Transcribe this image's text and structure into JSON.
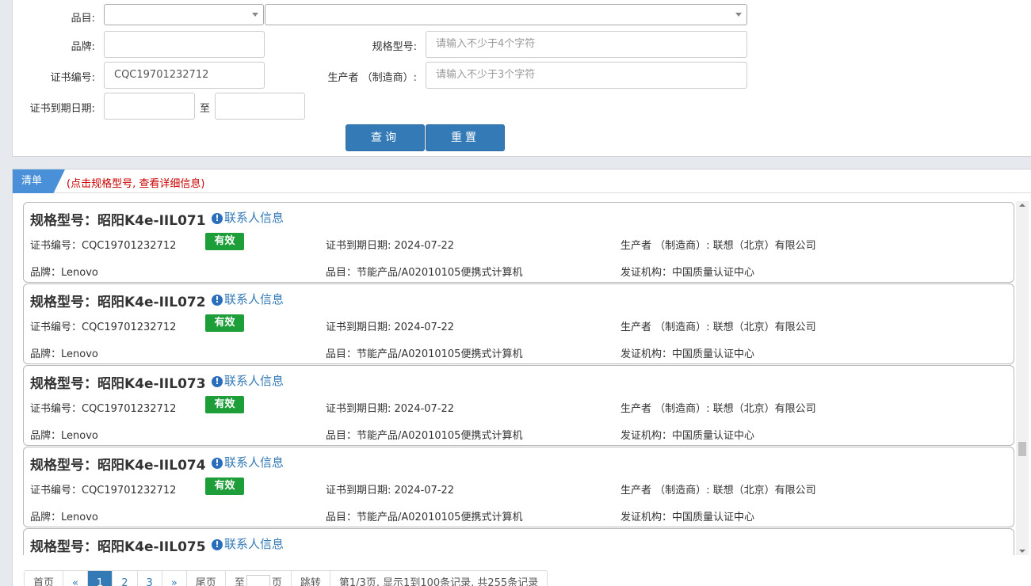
{
  "search": {
    "category_label": "品目:",
    "brand_label": "品牌:",
    "model_label": "规格型号:",
    "model_placeholder": "请输入不少于4个字符",
    "cert_no_label": "证书编号:",
    "cert_no_value": "CQC19701232712",
    "maker_label": "生产者 （制造商）:",
    "maker_placeholder": "请输入不少于3个字符",
    "expiry_label": "证书到期日期:",
    "expiry_to": "至",
    "query_button": "查询",
    "reset_button": "重置"
  },
  "list": {
    "tab_label": "清单",
    "hint": "(点击规格型号, 查看详细信息)",
    "items": [
      {
        "title": "规格型号：昭阳K4e-IIL071",
        "contact": "联系人信息",
        "cert": "证书编号：CQC19701232712",
        "status": "有效",
        "expiry": "证书到期日期: 2024-07-22",
        "maker": "生产者 （制造商）: 联想（北京）有限公司",
        "brand": "品牌：Lenovo",
        "category": "品目：节能产品/A02010105便携式计算机",
        "issuer": "发证机构：中国质量认证中心"
      },
      {
        "title": "规格型号：昭阳K4e-IIL072",
        "contact": "联系人信息",
        "cert": "证书编号：CQC19701232712",
        "status": "有效",
        "expiry": "证书到期日期: 2024-07-22",
        "maker": "生产者 （制造商）: 联想（北京）有限公司",
        "brand": "品牌：Lenovo",
        "category": "品目：节能产品/A02010105便携式计算机",
        "issuer": "发证机构：中国质量认证中心"
      },
      {
        "title": "规格型号：昭阳K4e-IIL073",
        "contact": "联系人信息",
        "cert": "证书编号：CQC19701232712",
        "status": "有效",
        "expiry": "证书到期日期: 2024-07-22",
        "maker": "生产者 （制造商）: 联想（北京）有限公司",
        "brand": "品牌：Lenovo",
        "category": "品目：节能产品/A02010105便携式计算机",
        "issuer": "发证机构：中国质量认证中心"
      },
      {
        "title": "规格型号：昭阳K4e-IIL074",
        "contact": "联系人信息",
        "cert": "证书编号：CQC19701232712",
        "status": "有效",
        "expiry": "证书到期日期: 2024-07-22",
        "maker": "生产者 （制造商）: 联想（北京）有限公司",
        "brand": "品牌：Lenovo",
        "category": "品目：节能产品/A02010105便携式计算机",
        "issuer": "发证机构：中国质量认证中心"
      },
      {
        "title": "规格型号：昭阳K4e-IIL075",
        "contact": "联系人信息"
      }
    ]
  },
  "pagination": {
    "first": "首页",
    "prev": "«",
    "pages": [
      "1",
      "2",
      "3"
    ],
    "next": "»",
    "last": "尾页",
    "goto_prefix": "至",
    "goto_suffix": "页",
    "jump": "跳转",
    "summary": "第1/3页, 显示1到100条记录, 共255条记录"
  },
  "colors": {
    "primary": "#337ab7",
    "valid_badge": "#1e9e39",
    "hint": "#cc0000"
  }
}
